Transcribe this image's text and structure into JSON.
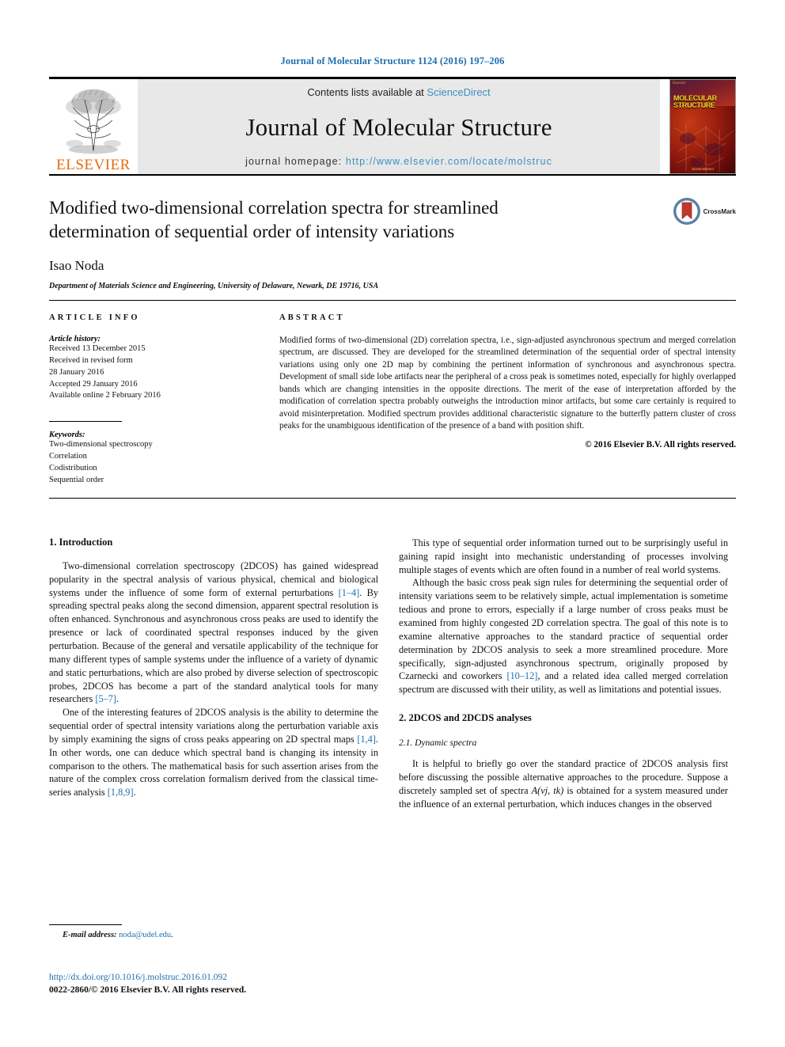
{
  "running_head": "Journal of Molecular Structure 1124 (2016) 197–206",
  "masthead": {
    "contents_prefix": "Contents lists available at ",
    "contents_link": "ScienceDirect",
    "journal_name": "Journal of Molecular Structure",
    "homepage_prefix": "journal homepage: ",
    "homepage_url": "http://www.elsevier.com/locate/molstruc",
    "publisher": "ELSEVIER",
    "cover_title_line1": "MOLECULAR",
    "cover_title_line2": "STRUCTURE",
    "cover_brand": "Elsevier",
    "cover_footer": "ScienceDirect"
  },
  "title": "Modified two-dimensional correlation spectra for streamlined determination of sequential order of intensity variations",
  "author": "Isao Noda",
  "affiliation": "Department of Materials Science and Engineering, University of Delaware, Newark, DE 19716, USA",
  "crossmark_label": "CrossMark",
  "article_info": {
    "heading": "ARTICLE INFO",
    "history_title": "Article history:",
    "history_lines": [
      "Received 13 December 2015",
      "Received in revised form",
      "28 January 2016",
      "Accepted 29 January 2016",
      "Available online 2 February 2016"
    ],
    "keywords_title": "Keywords:",
    "keywords": [
      "Two-dimensional spectroscopy",
      "Correlation",
      "Codistribution",
      "Sequential order"
    ]
  },
  "abstract": {
    "heading": "ABSTRACT",
    "text": "Modified forms of two-dimensional (2D) correlation spectra, i.e., sign-adjusted asynchronous spectrum and merged correlation spectrum, are discussed. They are developed for the streamlined determination of the sequential order of spectral intensity variations using only one 2D map by combining the pertinent information of synchronous and asynchronous spectra. Development of small side lobe artifacts near the peripheral of a cross peak is sometimes noted, especially for highly overlapped bands which are changing intensities in the opposite directions. The merit of the ease of interpretation afforded by the modification of correlation spectra probably outweighs the introduction minor artifacts, but some care certainly is required to avoid misinterpretation. Modified spectrum provides additional characteristic signature to the butterfly pattern cluster of cross peaks for the unambiguous identification of the presence of a band with position shift.",
    "copyright": "© 2016 Elsevier B.V. All rights reserved."
  },
  "body": {
    "section1_heading": "1. Introduction",
    "intro_p1_a": "Two-dimensional correlation spectroscopy (2DCOS) has gained widespread popularity in the spectral analysis of various physical, chemical and biological systems under the influence of some form of external perturbations ",
    "intro_p1_ref1": "[1–4]",
    "intro_p1_b": ". By spreading spectral peaks along the second dimension, apparent spectral resolution is often enhanced. Synchronous and asynchronous cross peaks are used to identify the presence or lack of coordinated spectral responses induced by the given perturbation. Because of the general and versatile applicability of the technique for many different types of sample systems under the influence of a variety of dynamic and static perturbations, which are also probed by diverse selection of spectroscopic probes, 2DCOS has become a part of the standard analytical tools for many researchers ",
    "intro_p1_ref2": "[5–7]",
    "intro_p1_c": ".",
    "intro_p2_a": "One of the interesting features of 2DCOS analysis is the ability to determine the sequential order of spectral intensity variations along the perturbation variable axis by simply examining the signs of cross peaks appearing on 2D spectral maps ",
    "intro_p2_ref1": "[1,4]",
    "intro_p2_b": ". In other words, one can deduce which spectral band is changing its intensity in comparison to the others. The mathematical basis for such assertion arises from the nature of the complex cross correlation formalism derived from the classical time-series analysis ",
    "intro_p2_ref2": "[1,8,9]",
    "intro_p2_c": ".",
    "intro_p3": "This type of sequential order information turned out to be surprisingly useful in gaining rapid insight into mechanistic understanding of processes involving multiple stages of events which are often found in a number of real world systems.",
    "intro_p4_a": "Although the basic cross peak sign rules for determining the sequential order of intensity variations seem to be relatively simple, actual implementation is sometime tedious and prone to errors, especially if a large number of cross peaks must be examined from highly congested 2D correlation spectra. The goal of this note is to examine alternative approaches to the standard practice of sequential order determination by 2DCOS analysis to seek a more streamlined procedure. More specifically, sign-adjusted asynchronous spectrum, originally proposed by Czarnecki and coworkers ",
    "intro_p4_ref1": "[10–12]",
    "intro_p4_b": ", and a related idea called merged correlation spectrum are discussed with their utility, as well as limitations and potential issues.",
    "section2_heading": "2. 2DCOS and 2DCDS analyses",
    "subsection21_heading": "2.1. Dynamic spectra",
    "sec21_p1_a": "It is helpful to briefly go over the standard practice of 2DCOS analysis first before discussing the possible alternative approaches to the procedure. Suppose a discretely sampled set of spectra ",
    "sec21_p1_math": "A(νj, tk)",
    "sec21_p1_b": " is obtained for a system measured under the influence of an external perturbation, which induces changes in the observed"
  },
  "footnote": {
    "label": "E-mail address:",
    "email": "noda@udel.edu",
    "trailer": "."
  },
  "footer": {
    "doi": "http://dx.doi.org/10.1016/j.molstruc.2016.01.092",
    "issn_line": "0022-2860/© 2016 Elsevier B.V. All rights reserved."
  },
  "colors": {
    "link": "#1f6fb0",
    "sciencedirect": "#3a8fc4",
    "elsevier_orange": "#E86A10"
  }
}
